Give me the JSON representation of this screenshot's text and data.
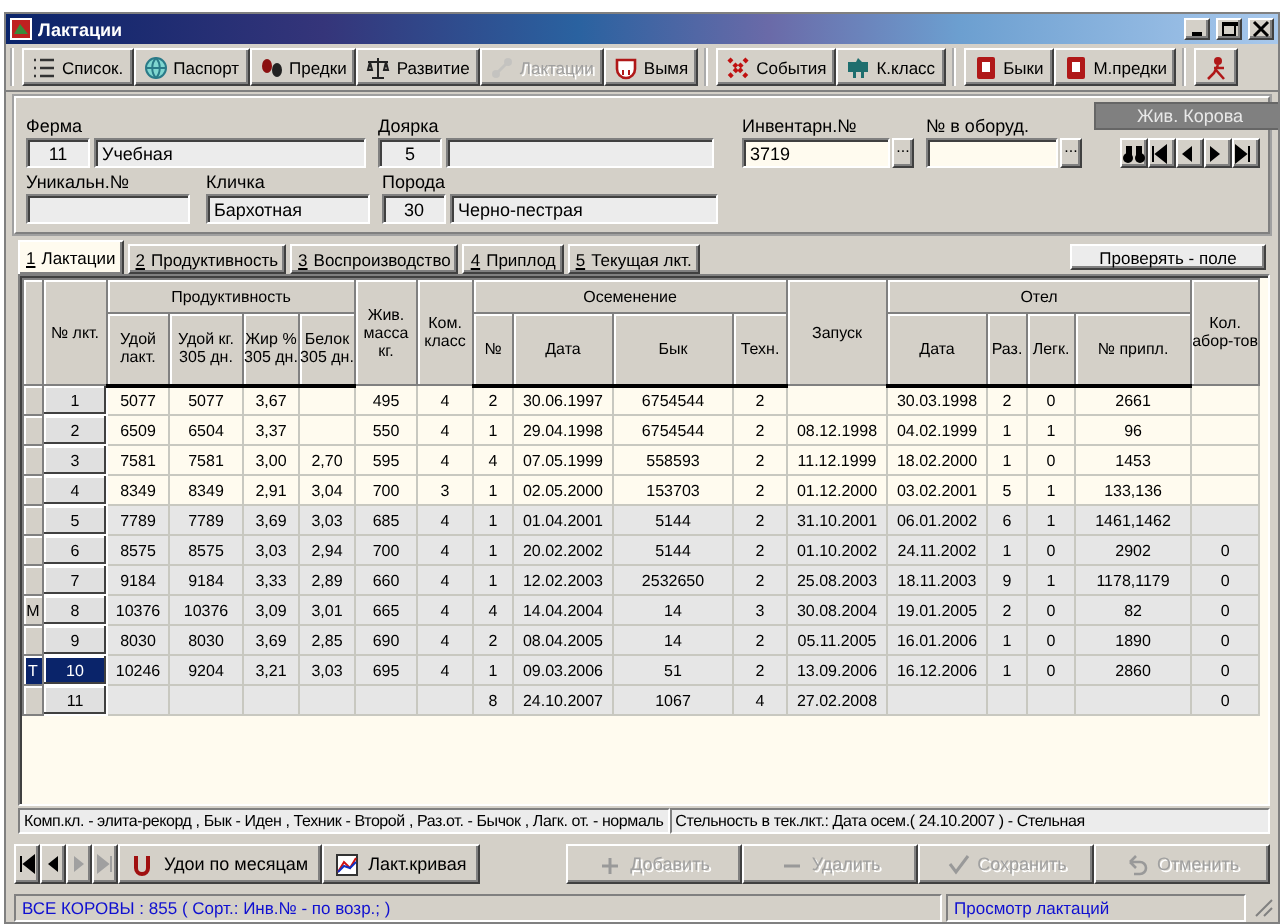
{
  "window": {
    "title": "Лактации"
  },
  "toolbar_groups": [
    {
      "buttons": [
        {
          "label": "Список.",
          "disabled": false
        },
        {
          "label": "Паспорт",
          "disabled": false
        },
        {
          "label": "Предки",
          "disabled": false
        },
        {
          "label": "Развитие",
          "disabled": false
        },
        {
          "label": "Лактации",
          "disabled": true
        },
        {
          "label": "Вымя",
          "disabled": false
        }
      ]
    },
    {
      "buttons": [
        {
          "label": "События",
          "disabled": false
        },
        {
          "label": "К.класс",
          "disabled": false
        }
      ]
    },
    {
      "buttons": [
        {
          "label": "Быки",
          "disabled": false
        },
        {
          "label": "М.предки",
          "disabled": false
        }
      ]
    },
    {
      "buttons": [
        {
          "disabled": false
        }
      ]
    }
  ],
  "form": {
    "farm": {
      "label": "Ферма",
      "code": "11",
      "name": "Учебная"
    },
    "milker": {
      "label": "Доярка",
      "code": "5"
    },
    "inventory_no": {
      "label": "Инвентарн.№",
      "value": "3719",
      "button": "..."
    },
    "equipment_no": {
      "label": "№ в оборуд.",
      "button": "..."
    },
    "status": "Жив. Корова",
    "unique_no": {
      "label": "Уникальн.№"
    },
    "nickname": {
      "label": "Кличка",
      "value": "Бархотная"
    },
    "breed": {
      "label": "Порода",
      "code": "30",
      "name": "Черно-пестрая"
    }
  },
  "tabs": [
    {
      "key": "1",
      "label": "Лактации",
      "selected": true
    },
    {
      "key": "2",
      "label": "Продуктивность",
      "selected": false
    },
    {
      "key": "3",
      "label": "Воспроизводство",
      "selected": false
    },
    {
      "key": "4",
      "label": "Приплод",
      "selected": false
    },
    {
      "key": "5",
      "label": "Текущая лкт.",
      "selected": false
    }
  ],
  "check_button": "Проверять - поле",
  "table": {
    "columns": [
      {
        "kind": "indicator"
      },
      {
        "label": "№ лкт."
      },
      {
        "label": "Продуктивность",
        "colspan": 4,
        "children": [
          {
            "label": "Удой лакт."
          },
          {
            "label": "Удой кг. 305 дн."
          },
          {
            "label": "Жир % 305 дн."
          },
          {
            "label": "Белок 305 дн."
          }
        ]
      },
      {
        "label": "Жив. масса кг."
      },
      {
        "label": "Ком. класс"
      },
      {
        "label": "Осеменение",
        "colspan": 4,
        "children": [
          {
            "label": "№"
          },
          {
            "label": "Дата"
          },
          {
            "label": "Бык"
          },
          {
            "label": "Техн."
          }
        ]
      },
      {
        "label": "Запуск"
      },
      {
        "label": "Отел",
        "colspan": 4,
        "children": [
          {
            "label": "Дата"
          },
          {
            "label": "Раз."
          },
          {
            "label": "Легк."
          },
          {
            "label": "№ припл."
          }
        ]
      },
      {
        "label": "Кол. абор-тов"
      }
    ],
    "rows": [
      {
        "selected": false,
        "shaded": false,
        "cells": [
          null,
          "1",
          "5077",
          "5077",
          "3,67",
          null,
          "495",
          "4",
          "2",
          "30.06.1997",
          "6754544",
          "2",
          null,
          "30.03.1998",
          "2",
          "0",
          "2661",
          null
        ]
      },
      {
        "selected": false,
        "shaded": false,
        "cells": [
          null,
          "2",
          "6509",
          "6504",
          "3,37",
          null,
          "550",
          "4",
          "1",
          "29.04.1998",
          "6754544",
          "2",
          "08.12.1998",
          "04.02.1999",
          "1",
          "1",
          "96",
          null
        ]
      },
      {
        "selected": false,
        "shaded": false,
        "cells": [
          null,
          "3",
          "7581",
          "7581",
          "3,00",
          "2,70",
          "595",
          "4",
          "4",
          "07.05.1999",
          "558593",
          "2",
          "11.12.1999",
          "18.02.2000",
          "1",
          "0",
          "1453",
          null
        ]
      },
      {
        "selected": false,
        "shaded": false,
        "cells": [
          null,
          "4",
          "8349",
          "8349",
          "2,91",
          "3,04",
          "700",
          "3",
          "1",
          "02.05.2000",
          "153703",
          "2",
          "01.12.2000",
          "03.02.2001",
          "5",
          "1",
          "133,136",
          null
        ]
      },
      {
        "selected": false,
        "shaded": true,
        "cells": [
          null,
          "5",
          "7789",
          "7789",
          "3,69",
          "3,03",
          "685",
          "4",
          "1",
          "01.04.2001",
          "5144",
          "2",
          "31.10.2001",
          "06.01.2002",
          "6",
          "1",
          "1461,1462",
          null
        ]
      },
      {
        "selected": false,
        "shaded": true,
        "cells": [
          null,
          "6",
          "8575",
          "8575",
          "3,03",
          "2,94",
          "700",
          "4",
          "1",
          "20.02.2002",
          "5144",
          "2",
          "01.10.2002",
          "24.11.2002",
          "1",
          "0",
          "2902",
          "0"
        ]
      },
      {
        "selected": false,
        "shaded": true,
        "cells": [
          null,
          "7",
          "9184",
          "9184",
          "3,33",
          "2,89",
          "660",
          "4",
          "1",
          "12.02.2003",
          "2532650",
          "2",
          "25.08.2003",
          "18.11.2003",
          "9",
          "1",
          "1178,1179",
          "0"
        ]
      },
      {
        "selected": false,
        "shaded": true,
        "cells": [
          "M",
          "8",
          "10376",
          "10376",
          "3,09",
          "3,01",
          "665",
          "4",
          "4",
          "14.04.2004",
          "14",
          "3",
          "30.08.2004",
          "19.01.2005",
          "2",
          "0",
          "82",
          "0"
        ]
      },
      {
        "selected": false,
        "shaded": true,
        "cells": [
          null,
          "9",
          "8030",
          "8030",
          "3,69",
          "2,85",
          "690",
          "4",
          "2",
          "08.04.2005",
          "14",
          "2",
          "05.11.2005",
          "16.01.2006",
          "1",
          "0",
          "1890",
          "0"
        ]
      },
      {
        "selected": true,
        "shaded": true,
        "cells": [
          "T",
          "10",
          "10246",
          "9204",
          "3,21",
          "3,03",
          "695",
          "4",
          "1",
          "09.03.2006",
          "51",
          "2",
          "13.09.2006",
          "16.12.2006",
          "1",
          "0",
          "2860",
          "0"
        ]
      },
      {
        "selected": false,
        "shaded": true,
        "cells": [
          null,
          "11",
          null,
          null,
          null,
          null,
          null,
          null,
          "8",
          "24.10.2007",
          "1067",
          "4",
          "27.02.2008",
          null,
          null,
          null,
          null,
          "0"
        ]
      }
    ]
  },
  "info": [
    "Комп.кл. - элита-рекорд , Бык - Иден , Техник - Второй , Раз.от. - Бычок , Лагк. от. - нормаль",
    "Стельность в тек.лкт.: Дата осем.( 24.10.2007 ) - Стельная"
  ],
  "record_nav": [
    {
      "disabled": false
    },
    {
      "disabled": false
    },
    {
      "disabled": true
    },
    {
      "disabled": true
    }
  ],
  "view_buttons": [
    {
      "label": "Удои по месяцам",
      "disabled": false
    },
    {
      "label": "Лакт.кривая",
      "disabled": false
    }
  ],
  "actions": [
    {
      "label": "Добавить",
      "disabled": true
    },
    {
      "label": "Удалить",
      "disabled": true
    },
    {
      "label": "Сохранить",
      "disabled": true
    },
    {
      "label": "Отменить",
      "disabled": true
    }
  ],
  "status_bar": {
    "left": "ВСЕ КОРОВЫ : 855 ( Сорт.: Инв.№ - по возр.; )",
    "right": "Просмотр лактаций"
  }
}
